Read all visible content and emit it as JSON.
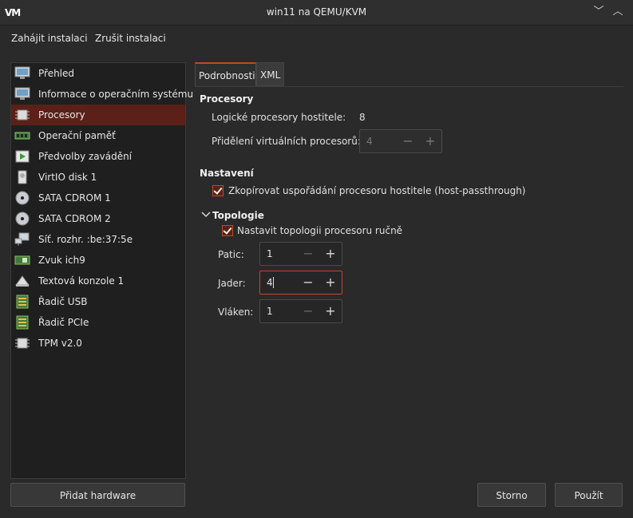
{
  "window": {
    "title": "win11 na QEMU/KVM",
    "logo": "VM",
    "minimize_icon": "﹀",
    "maximize_icon": "︿"
  },
  "menu": {
    "begin_install": "Zahájit instalaci",
    "cancel_install": "Zrušit instalaci"
  },
  "sidebar": {
    "items": [
      {
        "label": "Přehled",
        "icon": "monitor-icon"
      },
      {
        "label": "Informace o operačním systému",
        "icon": "monitor-icon"
      },
      {
        "label": "Procesory",
        "icon": "cpu-icon"
      },
      {
        "label": "Operační paměť",
        "icon": "memory-icon"
      },
      {
        "label": "Předvolby zavádění",
        "icon": "boot-icon"
      },
      {
        "label": "VirtIO disk 1",
        "icon": "disk-icon"
      },
      {
        "label": "SATA CDROM 1",
        "icon": "cdrom-icon"
      },
      {
        "label": "SATA CDROM 2",
        "icon": "cdrom-icon"
      },
      {
        "label": "Síť. rozhr. :be:37:5e",
        "icon": "network-icon"
      },
      {
        "label": "Zvuk ich9",
        "icon": "sound-card-icon"
      },
      {
        "label": "Textová konzole 1",
        "icon": "console-icon"
      },
      {
        "label": "Řadič USB",
        "icon": "controller-icon"
      },
      {
        "label": "Řadič PCIe",
        "icon": "controller-icon"
      },
      {
        "label": "TPM v2.0",
        "icon": "cpu-icon"
      }
    ],
    "add_hardware": "Přidat hardware"
  },
  "tabs": {
    "details": "Podrobnosti",
    "xml": "XML"
  },
  "cpu": {
    "section_title": "Procesory",
    "logical_label": "Logické procesory hostitele:",
    "logical_value": "8",
    "vcpu_label": "Přidělení virtuálních procesorů:",
    "vcpu_value": "4"
  },
  "config": {
    "section_title": "Nastavení",
    "copy_host_label": "Zkopírovat uspořádání procesoru hostitele (host-passthrough)"
  },
  "topology": {
    "section_title": "Topologie",
    "manual_label": "Nastavit topologii procesoru ručně",
    "sockets_label": "Patic:",
    "sockets_value": "1",
    "cores_label": "Jader:",
    "cores_value": "4",
    "threads_label": "Vláken:",
    "threads_value": "1"
  },
  "spin": {
    "minus": "−",
    "plus": "+"
  },
  "footer": {
    "cancel": "Storno",
    "apply": "Použít"
  },
  "colors": {
    "accent": "#c0492e",
    "selection": "#5b2018",
    "background": "#2a2a2a"
  }
}
